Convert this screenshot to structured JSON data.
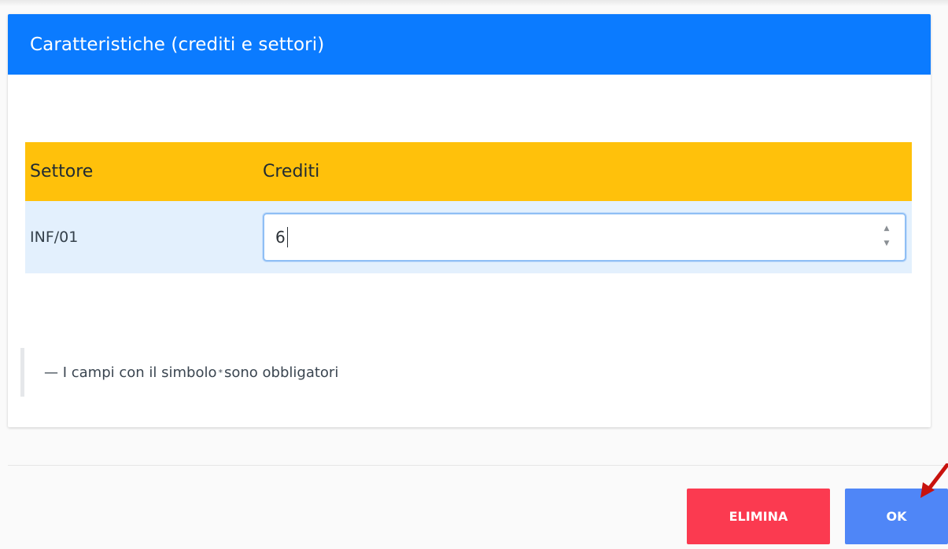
{
  "dialog": {
    "title": "Caratteristiche (crediti e settori)",
    "header_color": "#0b7bff"
  },
  "table": {
    "headers": {
      "settore": "Settore",
      "crediti": "Crediti"
    },
    "header_color": "#ffc10b",
    "rows": [
      {
        "settore": "INF/01",
        "crediti": "6"
      }
    ]
  },
  "note": {
    "prefix": "— I campi con il simbolo",
    "symbol": "*",
    "suffix": "sono obbligatori"
  },
  "actions": {
    "delete_label": "ELIMINA",
    "delete_color": "#fb3a50",
    "ok_label": "OK",
    "ok_color": "#4f86f7"
  },
  "annotation": {
    "arrow_color": "#c8120e",
    "target": "ok-button"
  },
  "icons": {
    "spinner_up": "chevron-up-icon",
    "spinner_down": "chevron-down-icon",
    "annotation": "arrow-pointer-icon"
  }
}
